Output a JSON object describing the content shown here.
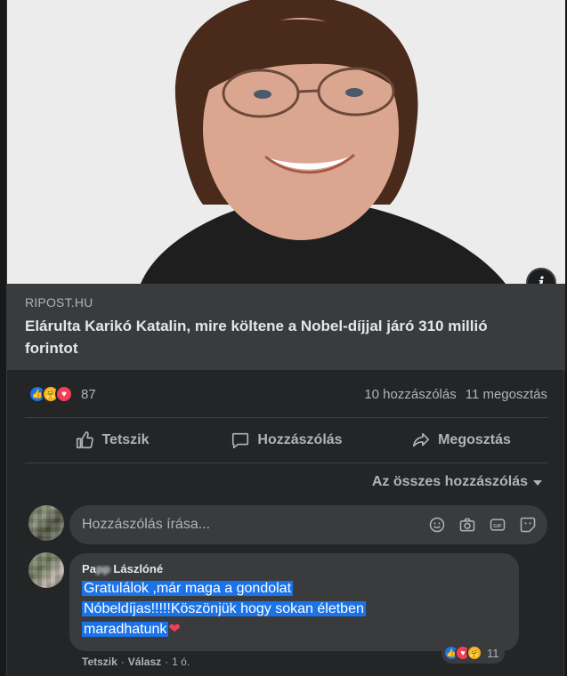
{
  "link": {
    "source": "RIPOST.HU",
    "title": "Elárulta Karikó Katalin, mire költene a Nobel-díjjal járó 310 millió forintot",
    "info_icon": "i"
  },
  "stats": {
    "reaction_icons": [
      "like-icon",
      "care-icon",
      "love-icon"
    ],
    "reaction_count": "87",
    "comments": "10 hozzászólás",
    "shares": "11 megosztás"
  },
  "actions": {
    "like": "Tetszik",
    "comment": "Hozzászólás",
    "share": "Megosztás"
  },
  "sort": {
    "label": "Az összes hozzászólás"
  },
  "composer": {
    "placeholder": "Hozzászólás írása..."
  },
  "comment": {
    "author": "Papp László",
    "author_prefix": "Pa",
    "author_rest": "László",
    "author_suffix": "né",
    "line1": "Gratulálok ,már maga a gondolat",
    "line2": "Nóbeldíjas!!!!!Köszönjük hogy sokan életben",
    "line3": "maradhatunk",
    "heart": "❤",
    "reaction_count": "11",
    "like_label": "Tetszik",
    "reply_label": "Válasz",
    "time": "1 ó."
  },
  "colors": {
    "background": "#242526",
    "surface": "#3a3b3c",
    "text": "#e4e6eb",
    "muted": "#b0b3b8",
    "highlight": "#1a73e8",
    "like": "#1b74e4",
    "love": "#f33e58"
  }
}
